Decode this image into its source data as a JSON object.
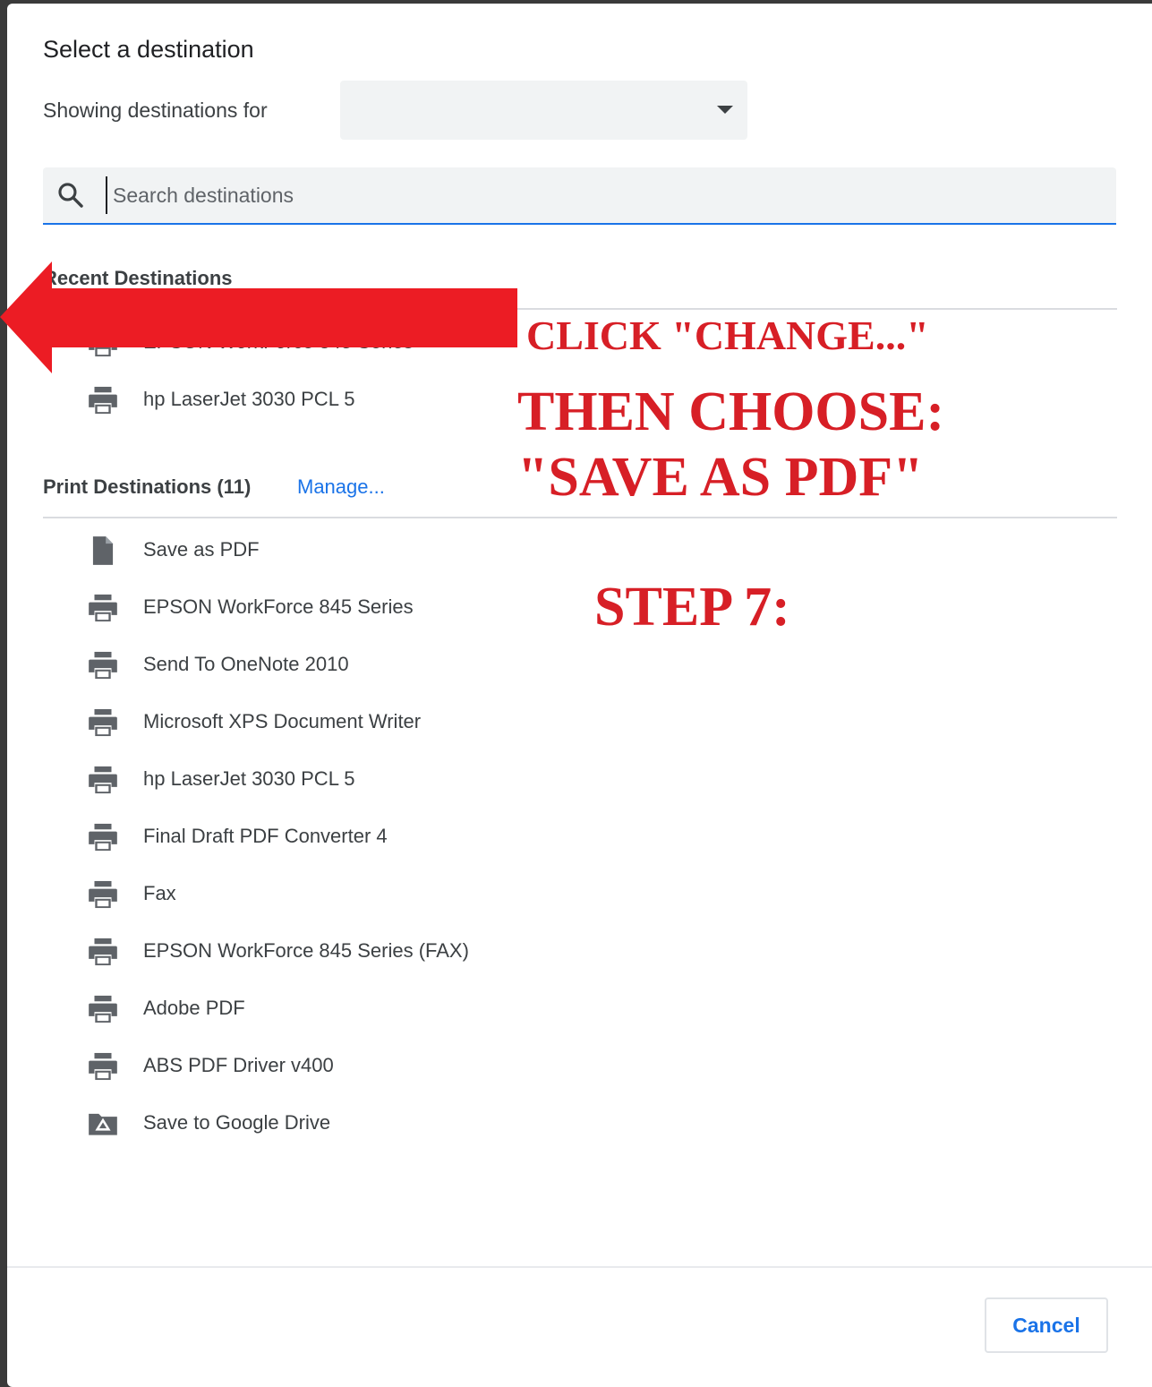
{
  "dialog": {
    "title": "Select a destination",
    "showing_label": "Showing destinations for",
    "showing_value": ""
  },
  "search": {
    "placeholder": "Search destinations",
    "icon": "search-icon"
  },
  "recent": {
    "header": "Recent Destinations",
    "items": [
      {
        "label": "EPSON WorkForce 845 Series",
        "icon": "printer-icon"
      },
      {
        "label": "hp LaserJet 3030 PCL 5",
        "icon": "printer-icon"
      }
    ]
  },
  "print_destinations": {
    "header": "Print Destinations (11)",
    "manage_label": "Manage...",
    "items": [
      {
        "label": "Save as PDF",
        "icon": "document-icon"
      },
      {
        "label": "EPSON WorkForce 845 Series",
        "icon": "printer-icon"
      },
      {
        "label": "Send To OneNote 2010",
        "icon": "printer-icon"
      },
      {
        "label": "Microsoft XPS Document Writer",
        "icon": "printer-icon"
      },
      {
        "label": "hp LaserJet 3030 PCL 5",
        "icon": "printer-icon"
      },
      {
        "label": "Final Draft PDF Converter 4",
        "icon": "printer-icon"
      },
      {
        "label": "Fax",
        "icon": "printer-icon"
      },
      {
        "label": "EPSON WorkForce 845 Series (FAX)",
        "icon": "printer-icon"
      },
      {
        "label": "Adobe PDF",
        "icon": "printer-icon"
      },
      {
        "label": "ABS PDF Driver v400",
        "icon": "printer-icon"
      },
      {
        "label": "Save to Google Drive",
        "icon": "drive-folder-icon"
      }
    ]
  },
  "footer": {
    "cancel_label": "Cancel"
  },
  "annotations": {
    "line1": "CLICK \"CHANGE...\"",
    "line2": "THEN CHOOSE:",
    "line3": "\"SAVE AS PDF\"",
    "line4": "STEP 7:",
    "color": "#d71f26"
  }
}
